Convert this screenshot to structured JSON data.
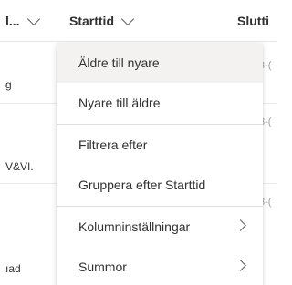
{
  "header": {
    "columns": [
      {
        "label": "l..."
      },
      {
        "label": "Starttid"
      },
      {
        "label": "Slutti"
      }
    ]
  },
  "rows": [
    {
      "text": "g",
      "right": "3-("
    },
    {
      "text": "V&VI.",
      "right": "3-("
    },
    {
      "text": "ıad",
      "right": "3-("
    }
  ],
  "menu": {
    "items": [
      {
        "label": "Äldre till nyare"
      },
      {
        "label": "Nyare till äldre"
      },
      {
        "label": "Filtrera efter"
      },
      {
        "label": "Gruppera efter Starttid"
      },
      {
        "label": "Kolumninställningar"
      },
      {
        "label": "Summor"
      }
    ]
  },
  "colors": {
    "text": "#323130",
    "hover": "#f3f2f1",
    "divider": "#e1dfdd"
  },
  "icons": [
    "chevron-down-icon",
    "chevron-right-icon"
  ]
}
